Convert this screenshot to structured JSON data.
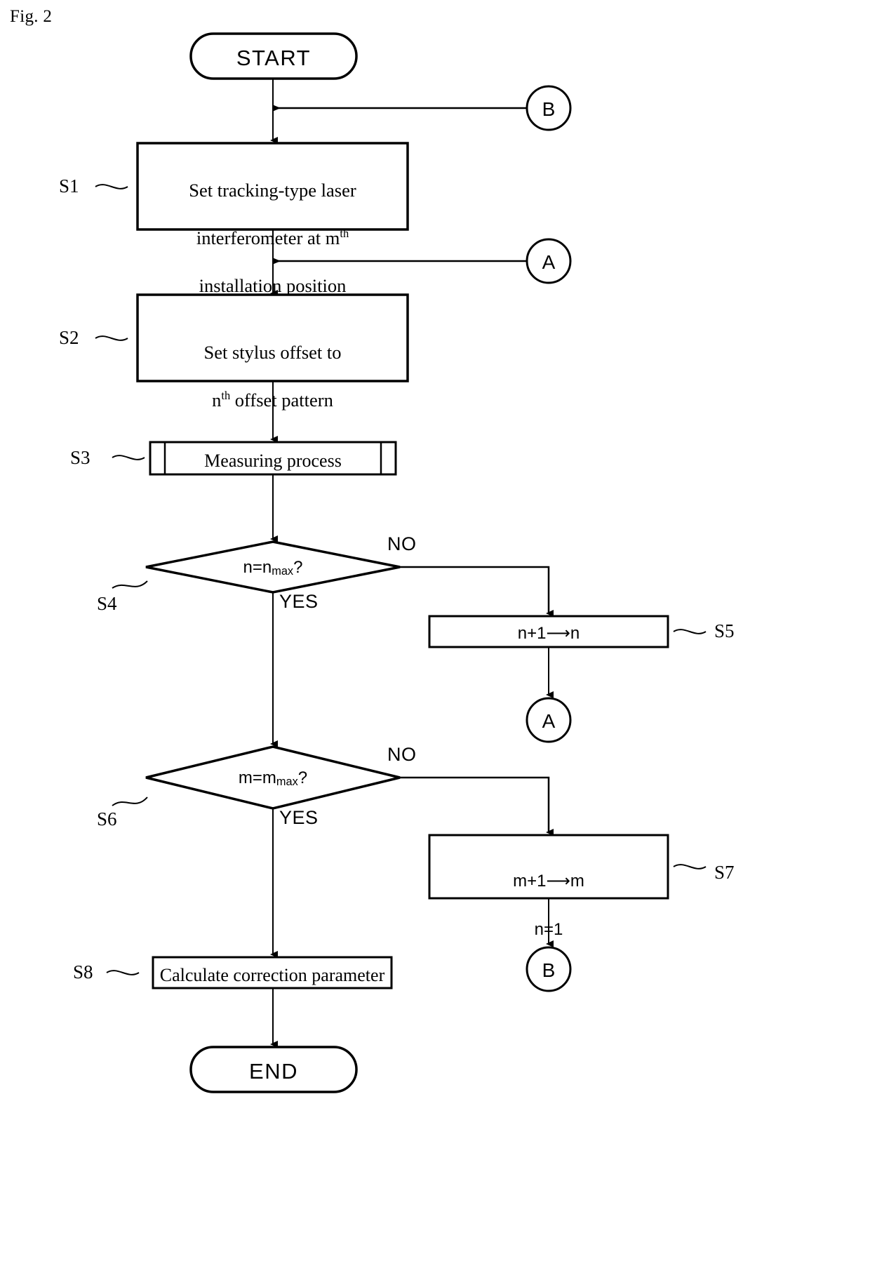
{
  "figure": {
    "label": "Fig. 2"
  },
  "flowchart": {
    "title": "Fig. 2",
    "nodes": {
      "start": {
        "id": "start",
        "shape": "terminator",
        "label": "START"
      },
      "s1": {
        "id": "S1",
        "shape": "process",
        "step": "S1",
        "line1": "Set tracking-type laser",
        "line2_a": "interferometer at m",
        "line2_sup": "th",
        "line3": "installation position"
      },
      "s2": {
        "id": "S2",
        "shape": "process",
        "step": "S2",
        "line1": "Set stylus offset to",
        "line2_a": "n",
        "line2_sup": "th",
        "line2_b": " offset pattern"
      },
      "s3": {
        "id": "S3",
        "shape": "predefined-process",
        "step": "S3",
        "label": "Measuring process"
      },
      "s4": {
        "id": "S4",
        "shape": "decision",
        "step": "S4",
        "var": "n=n",
        "sub": "max",
        "suffix": "?",
        "yes_label": "YES",
        "no_label": "NO"
      },
      "s5": {
        "id": "S5",
        "shape": "process",
        "step": "S5",
        "label": "n+1⟶n"
      },
      "s6": {
        "id": "S6",
        "shape": "decision",
        "step": "S6",
        "var": "m=m",
        "sub": "max",
        "suffix": "?",
        "yes_label": "YES",
        "no_label": "NO"
      },
      "s7": {
        "id": "S7",
        "shape": "process",
        "step": "S7",
        "line1": "m+1⟶m",
        "line2": "n=1"
      },
      "s8": {
        "id": "S8",
        "shape": "process",
        "step": "S8",
        "label": "Calculate correction parameter"
      },
      "end": {
        "id": "end",
        "shape": "terminator",
        "label": "END"
      },
      "connector_b_top": {
        "id": "B-top",
        "shape": "connector",
        "label": "B"
      },
      "connector_a_mid": {
        "id": "A-mid",
        "shape": "connector",
        "label": "A"
      },
      "connector_a_right": {
        "id": "A-right",
        "shape": "connector",
        "label": "A"
      },
      "connector_b_bottom": {
        "id": "B-bottom",
        "shape": "connector",
        "label": "B"
      }
    },
    "colors": {
      "stroke": "#000000",
      "fill": "#ffffff",
      "background": "#ffffff"
    }
  }
}
